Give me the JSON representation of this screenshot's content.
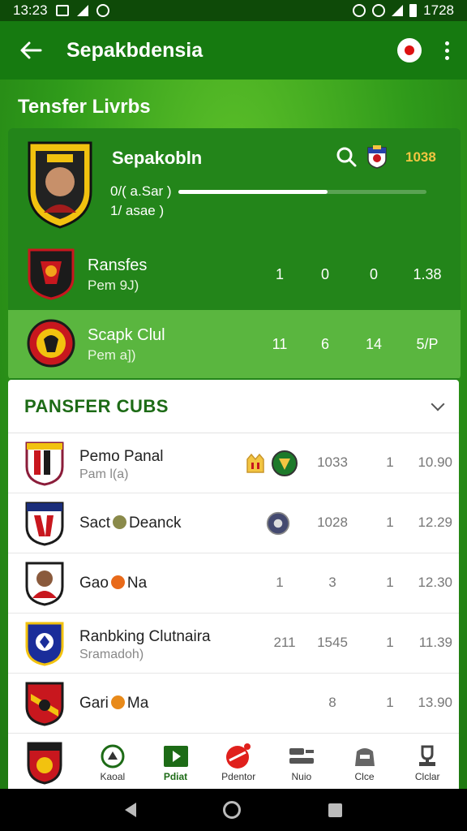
{
  "status_bar": {
    "time": "13:23",
    "battery_text": "1728"
  },
  "app_bar": {
    "title": "Sepakbdensia",
    "back_icon": "arrow-left-icon",
    "profile_icon": "profile-icon",
    "more_icon": "more-vertical-icon"
  },
  "section": {
    "title": "Tensfer Livrbs"
  },
  "featured": {
    "name": "Sepakobln",
    "line1": "0/( a.Sar )",
    "line2": "1/ asae )",
    "progress": 0.6,
    "score": "1038"
  },
  "clubs": [
    {
      "name": "Ransfes",
      "sub": "Pem 9J)",
      "stats": [
        "1",
        "0",
        "0",
        "1.38"
      ]
    },
    {
      "name": "Scapk Clul",
      "sub": "Pem a])",
      "stats": [
        "11",
        "6",
        "14",
        "5/P"
      ]
    }
  ],
  "list": {
    "title": "PANSFER CUBS",
    "rows": [
      {
        "name": "Pemo Panal",
        "sub": "Pam l(a)",
        "v1": "1033",
        "v2": "1",
        "v3": "10.90"
      },
      {
        "name_a": "Sact",
        "name_b": "Deanck",
        "v1": "1028",
        "v2": "1",
        "v3": "12.29"
      },
      {
        "name_a": "Gao",
        "name_b": "Na",
        "v0": "1",
        "v1": "3",
        "v2": "1",
        "v3": "12.30"
      },
      {
        "name": "Ranbking Clutnaira",
        "sub": "Sramadoh)",
        "v0": "211",
        "v1": "1545",
        "v2": "1",
        "v3": "11.39"
      },
      {
        "name_a": "Gari",
        "name_b": "Ma",
        "v1": "8",
        "v2": "1",
        "v3": "13.90"
      }
    ]
  },
  "bottom_nav": [
    {
      "label": "Kaoal",
      "icon": "whistle-icon"
    },
    {
      "label": "Pdiat",
      "icon": "play-icon"
    },
    {
      "label": "Pdentor",
      "icon": "ball-icon"
    },
    {
      "label": "Nuio",
      "icon": "news-icon"
    },
    {
      "label": "Clce",
      "icon": "shirt-icon"
    },
    {
      "label": "Clclar",
      "icon": "trophy-icon"
    }
  ],
  "colors": {
    "primary": "#167a10",
    "accent": "#1d6b16",
    "score": "#f3c542"
  }
}
